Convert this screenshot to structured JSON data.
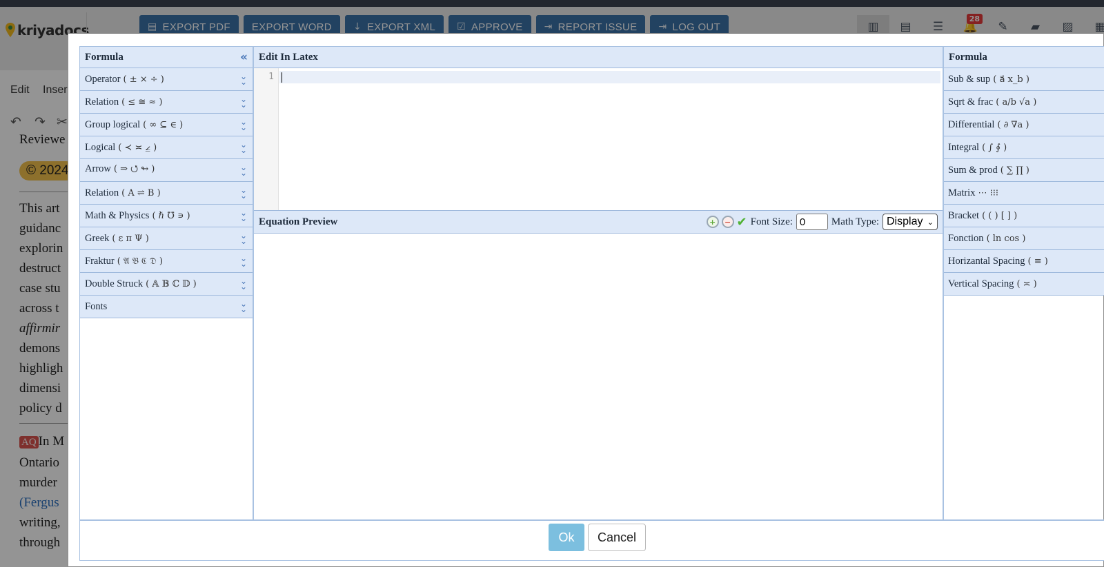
{
  "app": {
    "logo_text": "kriyadocs"
  },
  "toolbar": {
    "buttons": [
      {
        "label": "EXPORT PDF",
        "icon": "pdf-icon"
      },
      {
        "label": "EXPORT WORD",
        "icon": ""
      },
      {
        "label": "EXPORT XML",
        "icon": "download-icon"
      },
      {
        "label": "APPROVE",
        "icon": "checkbox-icon"
      },
      {
        "label": "REPORT ISSUE",
        "icon": "report-icon"
      },
      {
        "label": "LOG OUT",
        "icon": "logout-icon"
      }
    ],
    "notification_count": "28"
  },
  "editor_bg": {
    "menu": [
      "Edit",
      "Inser"
    ],
    "lines": [
      "Reviewe",
      "guidanc",
      "explorin",
      "destruct",
      "case stu",
      "across t",
      "affirmir",
      "demons",
      "highligh",
      "dimensi",
      "policy d",
      "In M",
      "Ontario",
      "murder",
      "(Fergus",
      "writing,",
      "through"
    ],
    "copyright": "© 2024",
    "first_para_start": "This art",
    "aq_tag": "AQ"
  },
  "dialog": {
    "left_panel": {
      "title": "Formula",
      "categories": [
        {
          "label": "Operator",
          "symbols": "( ± × ÷ )"
        },
        {
          "label": "Relation",
          "symbols": "( ≤ ≅ ≈ )"
        },
        {
          "label": "Group logical",
          "symbols": "( ∞ ⊆ ∈ )"
        },
        {
          "label": "Logical",
          "symbols": "( ≺ ≍ ⦤ )"
        },
        {
          "label": "Arrow",
          "symbols": "( ⇒ ⭯ ↬ )"
        },
        {
          "label": "Relation",
          "symbols": "( A ⇌ B )"
        },
        {
          "label": "Math & Physics",
          "symbols": "( ℏ ℧ ∍ )"
        },
        {
          "label": "Greek",
          "symbols": "( ε π Ψ )"
        },
        {
          "label": "Fraktur",
          "symbols": "( 𝔄 𝔅 ℭ 𝔇 )"
        },
        {
          "label": "Double Struck",
          "symbols": "( 𝔸 𝔹 ℂ 𝔻 )"
        },
        {
          "label": "Fonts",
          "symbols": ""
        }
      ]
    },
    "latex": {
      "title": "Edit In Latex",
      "line_number": "1",
      "content": ""
    },
    "preview": {
      "title": "Equation Preview",
      "font_size_label": "Font Size:",
      "font_size_value": "0",
      "math_type_label": "Math Type:",
      "math_type_value": "Display"
    },
    "right_panel": {
      "title": "Formula",
      "categories": [
        {
          "label": "Sub & sup",
          "symbols": "( a⃗ x_b )"
        },
        {
          "label": "Sqrt & frac",
          "symbols": "( a/b √a )"
        },
        {
          "label": "Differential",
          "symbols": "( ∂ ∇a )"
        },
        {
          "label": "Integral",
          "symbols": "( ∫ ∮ )"
        },
        {
          "label": "Sum & prod",
          "symbols": "( ∑ ∏ )"
        },
        {
          "label": "Matrix",
          "symbols": ""
        },
        {
          "label": "Bracket",
          "symbols": "( ( ) [ ] )"
        },
        {
          "label": "Fonction",
          "symbols": "( ln cos )"
        },
        {
          "label": "Horizantal Spacing",
          "symbols": "( ≡ )"
        },
        {
          "label": "Vertical Spacing",
          "symbols": "( ≍ )"
        }
      ]
    },
    "footer": {
      "ok_label": "Ok",
      "cancel_label": "Cancel"
    }
  }
}
